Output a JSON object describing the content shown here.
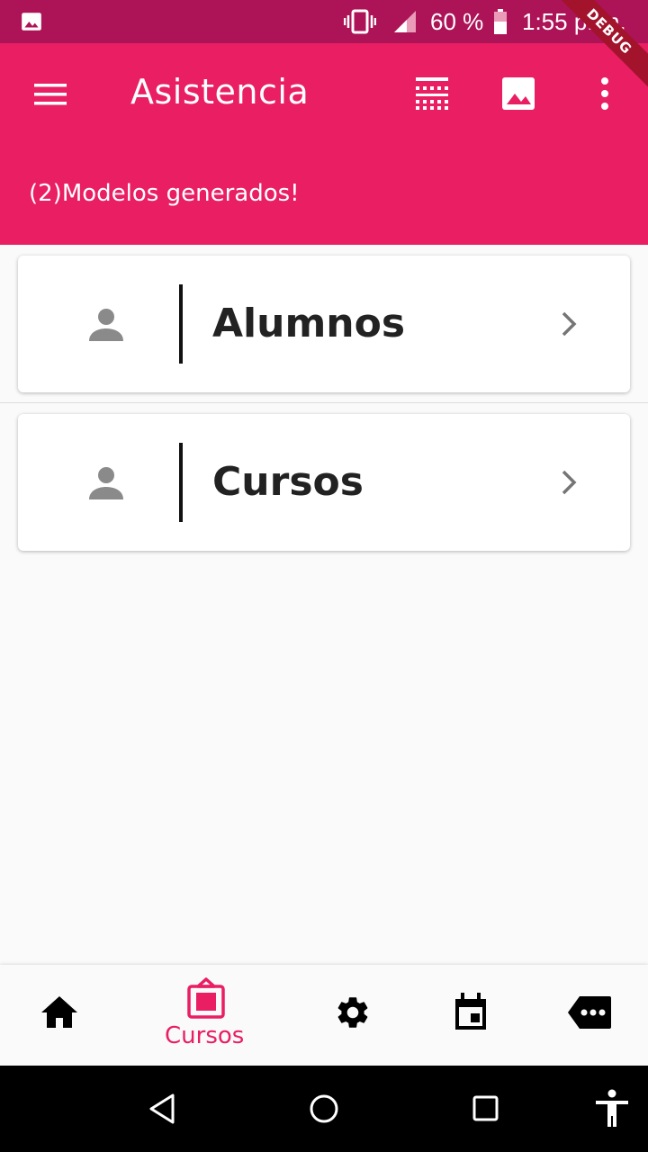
{
  "status_bar": {
    "battery": "60 %",
    "time": "1:55 p. m.",
    "debug_banner": "DEBUG"
  },
  "app_bar": {
    "title": "Asistencia",
    "subtitle": "(2)Modelos generados!",
    "background_color": "#e91e63"
  },
  "cards": [
    {
      "label": "Alumnos",
      "icon": "person-icon"
    },
    {
      "label": "Cursos",
      "icon": "person-icon"
    }
  ],
  "bottom_nav": {
    "items": [
      {
        "icon": "home-icon"
      },
      {
        "icon": "class-icon",
        "label": "Cursos",
        "active": true
      },
      {
        "icon": "settings-icon"
      },
      {
        "icon": "calendar-icon"
      },
      {
        "icon": "more-tag-icon"
      }
    ],
    "active_color": "#e91e63"
  }
}
